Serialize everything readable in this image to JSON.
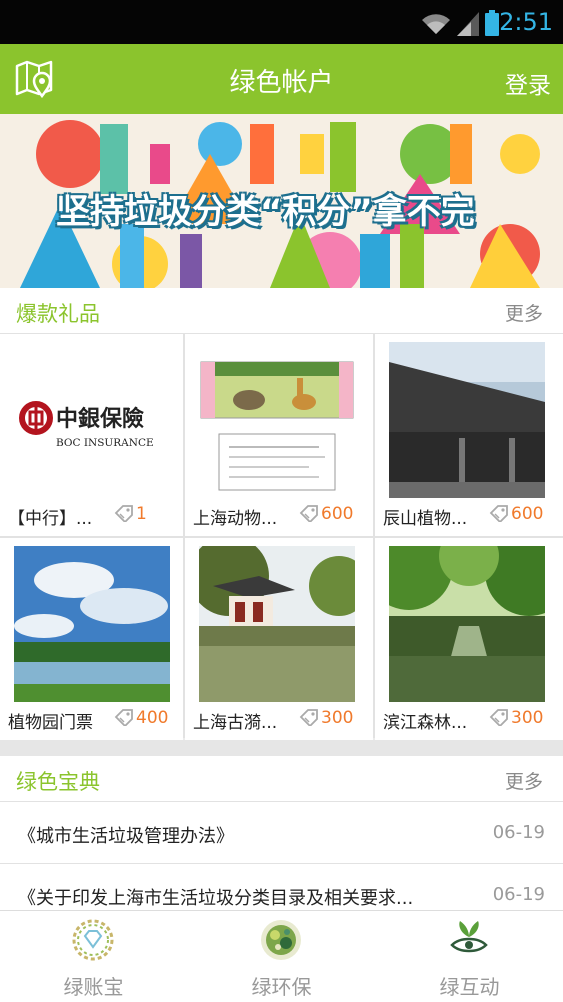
{
  "status_bar": {
    "time": "2:51"
  },
  "header": {
    "title": "绿色帐户",
    "login_label": "登录"
  },
  "banner": {
    "text": "坚持垃圾分类“积分”拿不完"
  },
  "gifts": {
    "title": "爆款礼品",
    "more_label": "更多",
    "items": [
      {
        "name": "【中行】...",
        "points": "1",
        "thumb": "boc-insurance-logo"
      },
      {
        "name": "上海动物...",
        "points": "600",
        "thumb": "zoo-ticket"
      },
      {
        "name": "辰山植物...",
        "points": "600",
        "thumb": "chenshan-gate"
      },
      {
        "name": "植物园门票",
        "points": "400",
        "thumb": "botanical-lake"
      },
      {
        "name": "上海古漪...",
        "points": "300",
        "thumb": "guyi-garden"
      },
      {
        "name": "滨江森林...",
        "points": "300",
        "thumb": "binjiang-forest"
      }
    ]
  },
  "boc_logo": {
    "cn": "中銀保險",
    "en": "BOC INSURANCE"
  },
  "guide": {
    "title": "绿色宝典",
    "more_label": "更多",
    "items": [
      {
        "title": "《城市生活垃圾管理办法》",
        "date": "06-19"
      },
      {
        "title": "《关于印发上海市生活垃圾分类目录及相关要求...",
        "date": "06-19"
      }
    ]
  },
  "bottom_nav": [
    {
      "label": "绿账宝",
      "icon": "diamond-wreath-icon"
    },
    {
      "label": "绿环保",
      "icon": "globe-wreath-icon"
    },
    {
      "label": "绿互动",
      "icon": "leaf-eye-icon"
    }
  ],
  "colors": {
    "accent": "#8bc42d",
    "points": "#f07a2c",
    "status_blue": "#34b5e5"
  }
}
